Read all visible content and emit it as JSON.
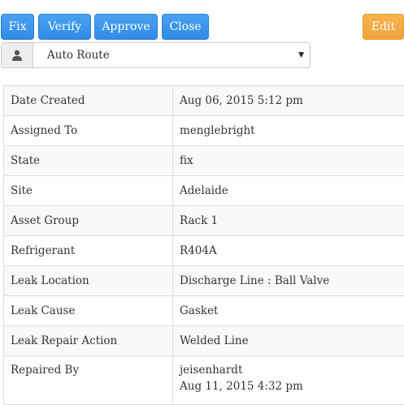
{
  "toolbar": {
    "fix_label": "Fix",
    "verify_label": "Verify",
    "approve_label": "Approve",
    "close_label": "Close",
    "edit_label": "Edit"
  },
  "assignee_select": {
    "icon": "user-icon",
    "value": "Auto Route"
  },
  "details": [
    {
      "label": "Date Created",
      "value": "Aug 06, 2015 5:12 pm"
    },
    {
      "label": "Assigned To",
      "value": "menglebright"
    },
    {
      "label": "State",
      "value": "fix"
    },
    {
      "label": "Site",
      "value": "Adelaide"
    },
    {
      "label": "Asset Group",
      "value": "Rack 1"
    },
    {
      "label": "Refrigerant",
      "value": "R404A"
    },
    {
      "label": "Leak Location",
      "value": "Discharge Line : Ball Valve"
    },
    {
      "label": "Leak Cause",
      "value": "Gasket"
    },
    {
      "label": "Leak Repair Action",
      "value": "Welded Line"
    },
    {
      "label": "Repaired By",
      "value": "jeisenhardt",
      "value2": "Aug 11, 2015 4:32 pm"
    }
  ],
  "colors": {
    "primary": "#3a95ec",
    "warning": "#f0a43a"
  }
}
